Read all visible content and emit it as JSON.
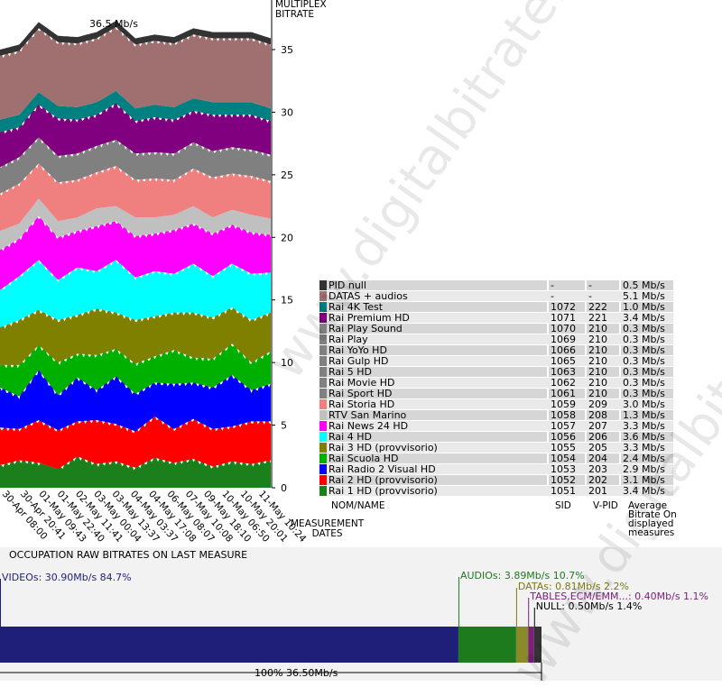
{
  "chart_data": [
    {
      "type": "area",
      "title": "36.5 Mb/s",
      "ylabel": "MULTIPLEX BITRATE",
      "xlabel": "MEASUREMENT DATES",
      "ylim": [
        0,
        38
      ],
      "yticks": [
        0,
        5,
        10,
        15,
        20,
        25,
        30,
        35
      ],
      "x": [
        "30-Apr 08:00",
        "30-Apr 20:41",
        "01-May 09:43",
        "01-May 22:40",
        "02-May 11:41",
        "03-May 00:04",
        "03-May 13:37",
        "04-May 03:37",
        "04-May 17:08",
        "06-May 08:07",
        "07-May 10:08",
        "09-May 18:10",
        "10-May 06:50",
        "10-May 20:01",
        "11-May 10:24"
      ],
      "series": [
        {
          "name": "Rai 1 HD (provvisorio)",
          "color": "#1b7f1b",
          "values": [
            1.8,
            2.2,
            2.0,
            1.5,
            2.5,
            1.9,
            2.1,
            1.6,
            2.4,
            2.0,
            2.3,
            1.7,
            2.1,
            1.9,
            2.2
          ]
        },
        {
          "name": "Rai 2 HD (provvisorio)",
          "color": "#ff0000",
          "values": [
            3.0,
            2.5,
            3.4,
            3.1,
            2.8,
            3.5,
            3.0,
            2.9,
            3.3,
            2.7,
            3.2,
            3.0,
            2.8,
            3.4,
            3.1
          ]
        },
        {
          "name": "Rai Radio 2 Visual HD",
          "color": "#0000ff",
          "values": [
            3.2,
            2.6,
            4.0,
            2.8,
            3.5,
            2.4,
            3.8,
            3.0,
            2.7,
            3.6,
            2.9,
            3.3,
            4.1,
            2.5,
            3.0
          ]
        },
        {
          "name": "Rai Scuola HD",
          "color": "#00b000",
          "values": [
            1.8,
            2.5,
            2.0,
            2.6,
            1.9,
            2.8,
            2.2,
            2.4,
            2.1,
            2.7,
            2.0,
            2.3,
            2.5,
            2.2,
            2.6
          ]
        },
        {
          "name": "Rai 3 HD (provvisorio)",
          "color": "#808000",
          "values": [
            3.0,
            3.6,
            2.8,
            3.4,
            3.1,
            3.7,
            2.9,
            3.5,
            3.2,
            3.0,
            3.6,
            3.3,
            2.9,
            3.4,
            3.1
          ]
        },
        {
          "name": "Rai 4 HD",
          "color": "#00ffff",
          "values": [
            3.0,
            3.5,
            4.0,
            3.2,
            3.8,
            3.0,
            4.2,
            3.4,
            3.6,
            3.1,
            3.9,
            3.3,
            3.5,
            3.7,
            3.2
          ]
        },
        {
          "name": "Rai News 24 HD",
          "color": "#ff00ff",
          "values": [
            3.2,
            3.0,
            3.5,
            3.4,
            2.9,
            3.6,
            3.1,
            3.3,
            3.0,
            3.5,
            3.2,
            3.4,
            3.1,
            3.3,
            3.0
          ]
        },
        {
          "name": "RTV San Marino",
          "color": "#c0c0c0",
          "values": [
            1.5,
            1.2,
            1.4,
            1.3,
            1.1,
            1.4,
            1.2,
            1.5,
            1.3,
            1.2,
            1.4,
            1.3,
            1.2,
            1.4,
            1.3
          ]
        },
        {
          "name": "Rai Storia HD",
          "color": "#f08080",
          "values": [
            3.0,
            3.2,
            2.8,
            3.1,
            3.0,
            2.9,
            3.2,
            3.0,
            3.1,
            2.8,
            3.0,
            3.2,
            2.9,
            3.1,
            3.0
          ]
        },
        {
          "name": "Rai Play Sound … Rai Sport HD",
          "color": "#808080",
          "values": [
            2.1,
            2.1,
            2.1,
            2.1,
            2.1,
            2.1,
            2.1,
            2.1,
            2.1,
            2.1,
            2.1,
            2.1,
            2.1,
            2.1,
            2.1
          ]
        },
        {
          "name": "Rai Premium HD",
          "color": "#800080",
          "values": [
            2.8,
            2.4,
            2.6,
            3.0,
            2.7,
            2.5,
            2.9,
            2.6,
            2.8,
            2.7,
            2.5,
            2.9,
            2.6,
            2.8,
            2.7
          ]
        },
        {
          "name": "Rai 4K Test",
          "color": "#008080",
          "values": [
            1.0,
            1.0,
            1.0,
            1.0,
            1.0,
            1.0,
            1.0,
            1.0,
            1.0,
            1.0,
            1.0,
            1.0,
            1.0,
            1.0,
            1.0
          ]
        },
        {
          "name": "DATAS + audios",
          "color": "#a07070",
          "values": [
            5.1,
            5.1,
            5.1,
            5.1,
            5.1,
            5.1,
            5.1,
            5.1,
            5.1,
            5.1,
            5.1,
            5.1,
            5.1,
            5.1,
            5.1
          ]
        },
        {
          "name": "PID null",
          "color": "#333333",
          "values": [
            0.5,
            0.5,
            0.5,
            0.5,
            0.5,
            0.5,
            0.5,
            0.5,
            0.5,
            0.5,
            0.5,
            0.5,
            0.5,
            0.5,
            0.5
          ]
        }
      ]
    },
    {
      "type": "bar",
      "title": "OCCUPATION RAW BITRATES ON LAST MEASURE",
      "total_label": "100%  36.50Mb/s",
      "series": [
        {
          "name": "VIDEOs",
          "label": "VIDEOs: 30.90Mb/s  84.7%",
          "value": 30.9,
          "percent": 84.7,
          "color": "#1f1f7a",
          "text_color": "#1f1f7a"
        },
        {
          "name": "AUDIOs",
          "label": "AUDIOs: 3.89Mb/s  10.7%",
          "value": 3.89,
          "percent": 10.7,
          "color": "#1d7a1d",
          "text_color": "#1d7a1d"
        },
        {
          "name": "DATAs",
          "label": "DATAs: 0.81Mb/s  2.2%",
          "value": 0.81,
          "percent": 2.2,
          "color": "#8a8a2a",
          "text_color": "#7a7a10"
        },
        {
          "name": "TABLES,ECM/EMM...",
          "label": "TABLES,ECM/EMM...: 0.40Mb/s  1.1%",
          "value": 0.4,
          "percent": 1.1,
          "color": "#7a207a",
          "text_color": "#7a207a"
        },
        {
          "name": "NULL",
          "label": "NULL: 0.50Mb/s  1.4%",
          "value": 0.5,
          "percent": 1.4,
          "color": "#333333",
          "text_color": "#000000"
        }
      ]
    }
  ],
  "legend": {
    "headers": {
      "name": "NOM/NAME",
      "sid": "SID",
      "vpid": "V-PID",
      "avg": "Average Bitrate On displayed measures"
    },
    "rows": [
      {
        "color": "#333333",
        "name": "PID null",
        "sid": "-",
        "vpid": "-",
        "avg": "0.5 Mb/s"
      },
      {
        "color": "#a07070",
        "name": "DATAS + audios",
        "sid": "-",
        "vpid": "-",
        "avg": "5.1 Mb/s"
      },
      {
        "color": "#008080",
        "name": "Rai 4K Test",
        "sid": "1072",
        "vpid": "222",
        "avg": "1.0 Mb/s"
      },
      {
        "color": "#800080",
        "name": "Rai Premium HD",
        "sid": "1071",
        "vpid": "221",
        "avg": "3.4 Mb/s"
      },
      {
        "color": "#808080",
        "name": "Rai Play Sound",
        "sid": "1070",
        "vpid": "210",
        "avg": "0.3 Mb/s"
      },
      {
        "color": "#808080",
        "name": "Rai Play",
        "sid": "1069",
        "vpid": "210",
        "avg": "0.3 Mb/s"
      },
      {
        "color": "#808080",
        "name": "Rai YoYo HD",
        "sid": "1066",
        "vpid": "210",
        "avg": "0.3 Mb/s"
      },
      {
        "color": "#808080",
        "name": "Rai Gulp HD",
        "sid": "1065",
        "vpid": "210",
        "avg": "0.3 Mb/s"
      },
      {
        "color": "#808080",
        "name": "Rai 5 HD",
        "sid": "1063",
        "vpid": "210",
        "avg": "0.3 Mb/s"
      },
      {
        "color": "#808080",
        "name": "Rai Movie HD",
        "sid": "1062",
        "vpid": "210",
        "avg": "0.3 Mb/s"
      },
      {
        "color": "#808080",
        "name": "Rai Sport HD",
        "sid": "1061",
        "vpid": "210",
        "avg": "0.3 Mb/s"
      },
      {
        "color": "#f08080",
        "name": "Rai Storia HD",
        "sid": "1059",
        "vpid": "209",
        "avg": "3.0 Mb/s"
      },
      {
        "color": "#c0c0c0",
        "name": "RTV San Marino",
        "sid": "1058",
        "vpid": "208",
        "avg": "1.3 Mb/s"
      },
      {
        "color": "#ff00ff",
        "name": "Rai News 24 HD",
        "sid": "1057",
        "vpid": "207",
        "avg": "3.3 Mb/s"
      },
      {
        "color": "#00ffff",
        "name": "Rai 4 HD",
        "sid": "1056",
        "vpid": "206",
        "avg": "3.6 Mb/s"
      },
      {
        "color": "#808000",
        "name": "Rai 3 HD (provvisorio)",
        "sid": "1055",
        "vpid": "205",
        "avg": "3.3 Mb/s"
      },
      {
        "color": "#00b000",
        "name": "Rai Scuola HD",
        "sid": "1054",
        "vpid": "204",
        "avg": "2.4 Mb/s"
      },
      {
        "color": "#0000ff",
        "name": "Rai Radio 2 Visual HD",
        "sid": "1053",
        "vpid": "203",
        "avg": "2.9 Mb/s"
      },
      {
        "color": "#ff0000",
        "name": "Rai 2 HD (provvisorio)",
        "sid": "1052",
        "vpid": "202",
        "avg": "3.1 Mb/s"
      },
      {
        "color": "#1b7f1b",
        "name": "Rai 1 HD (provvisorio)",
        "sid": "1051",
        "vpid": "201",
        "avg": "3.4 Mb/s"
      }
    ]
  },
  "axis": {
    "y_title_line1": "MULTIPLEX",
    "y_title_line2": "BITRATE",
    "x_title_line1": "MEASUREMENT",
    "x_title_line2": "DATES"
  },
  "watermark": "www.digitalbitrate.com"
}
